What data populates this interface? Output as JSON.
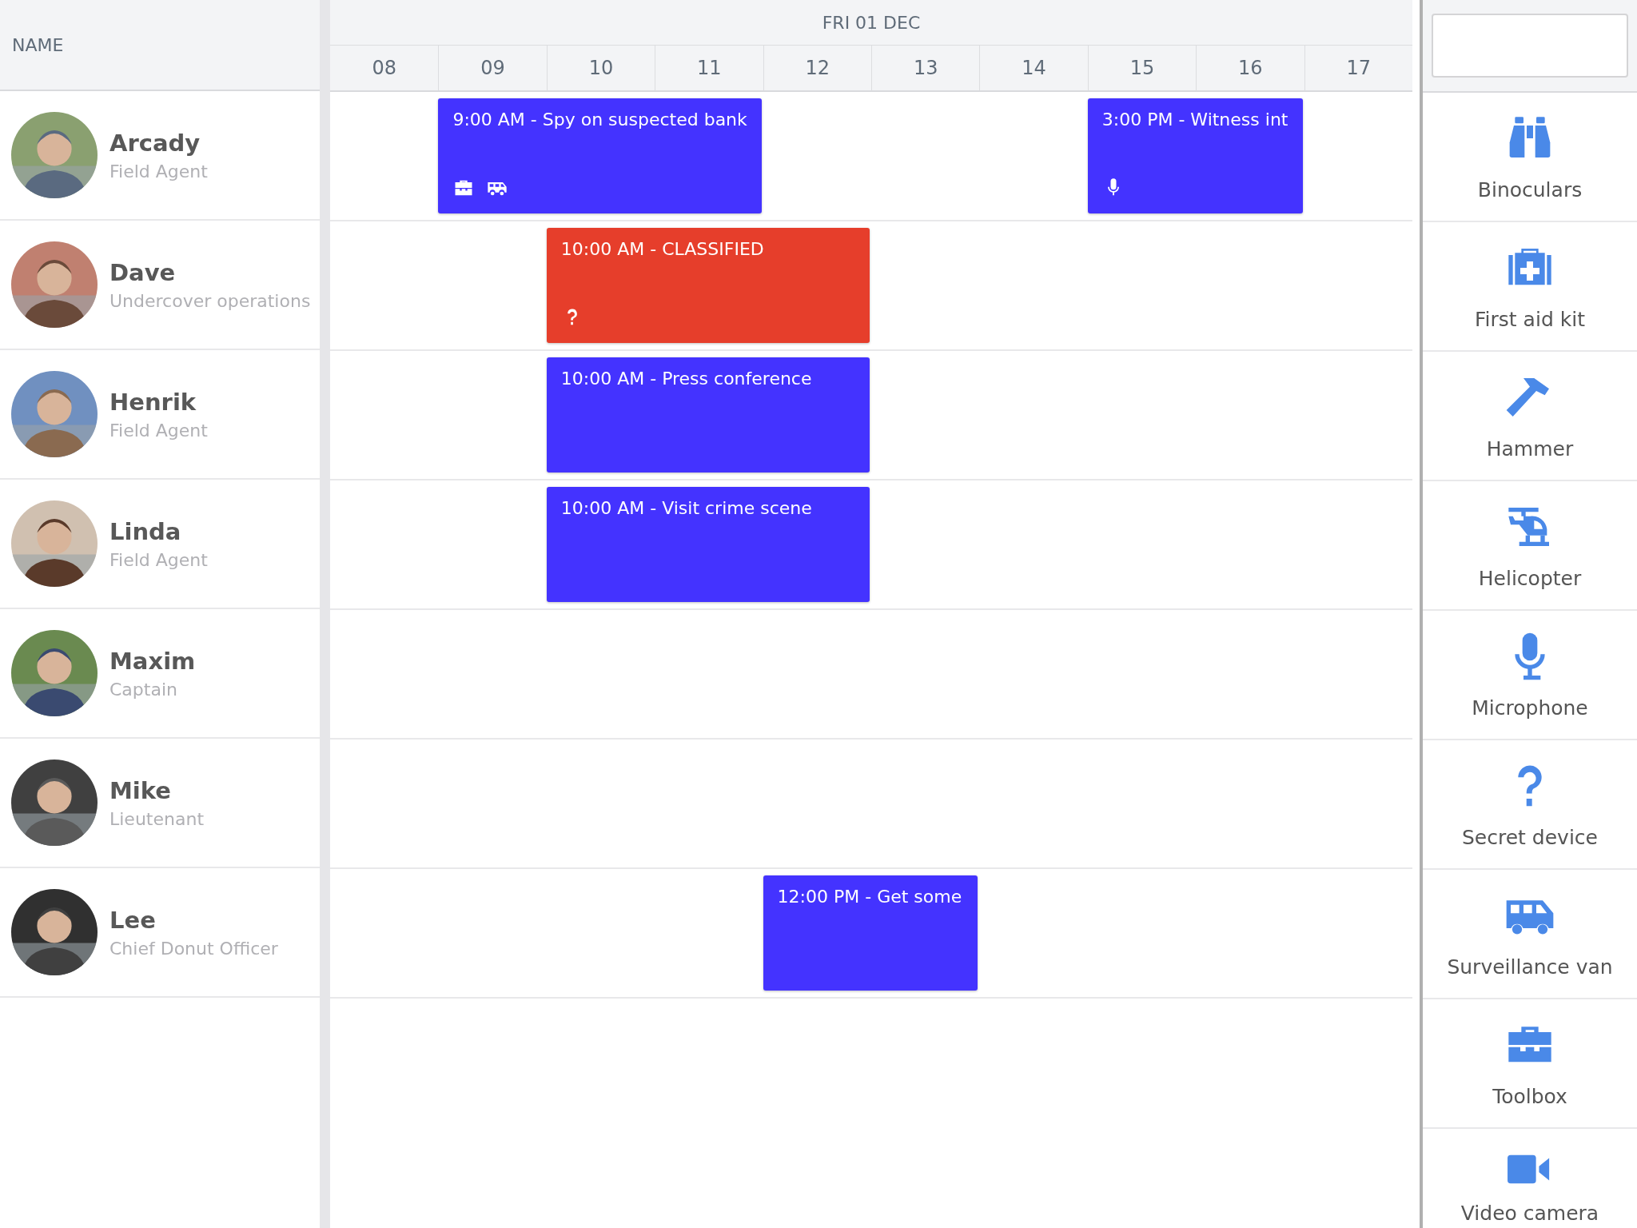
{
  "name_header": "NAME",
  "day": "FRI 01 DEC",
  "hours": [
    "08",
    "09",
    "10",
    "11",
    "12",
    "13",
    "14",
    "15",
    "16",
    "17"
  ],
  "people": [
    {
      "name": "Arcady",
      "role": "Field Agent",
      "events": [
        {
          "title": "9:00 AM - Spy on suspected bank",
          "color": "#4433ff",
          "icons": [
            {
              "kind": "toolbox"
            },
            {
              "kind": "van"
            }
          ]
        },
        {
          "title": "3:00 PM - Witness int",
          "color": "#4433ff",
          "icons": [
            {
              "kind": "microphone"
            }
          ]
        }
      ]
    },
    {
      "name": "Dave",
      "role": "Undercover operations",
      "events": [
        {
          "title": "10:00 AM - CLASSIFIED",
          "color": "#e63e2b",
          "icons": [
            {
              "kind": "question"
            }
          ]
        }
      ]
    },
    {
      "name": "Henrik",
      "role": "Field Agent",
      "events": [
        {
          "title": "10:00 AM - Press conference",
          "color": "#4433ff"
        }
      ]
    },
    {
      "name": "Linda",
      "role": "Field Agent",
      "events": [
        {
          "title": "10:00 AM - Visit crime scene",
          "color": "#4433ff"
        }
      ]
    },
    {
      "name": "Maxim",
      "role": "Captain"
    },
    {
      "name": "Mike",
      "role": "Lieutenant"
    },
    {
      "name": "Lee",
      "role": "Chief Donut Officer",
      "events": [
        {
          "title": "12:00 PM - Get some",
          "color": "#4433ff"
        }
      ]
    }
  ],
  "resources": [
    {
      "label": "Binoculars",
      "kind": "binoculars"
    },
    {
      "label": "First aid kit",
      "kind": "firstaid"
    },
    {
      "label": "Hammer",
      "kind": "hammer"
    },
    {
      "label": "Helicopter",
      "kind": "helicopter"
    },
    {
      "label": "Microphone",
      "kind": "microphone"
    },
    {
      "label": "Secret device",
      "kind": "question"
    },
    {
      "label": "Surveillance van",
      "kind": "van"
    },
    {
      "label": "Toolbox",
      "kind": "toolbox"
    },
    {
      "label": "Video camera",
      "kind": "videocamera"
    }
  ]
}
